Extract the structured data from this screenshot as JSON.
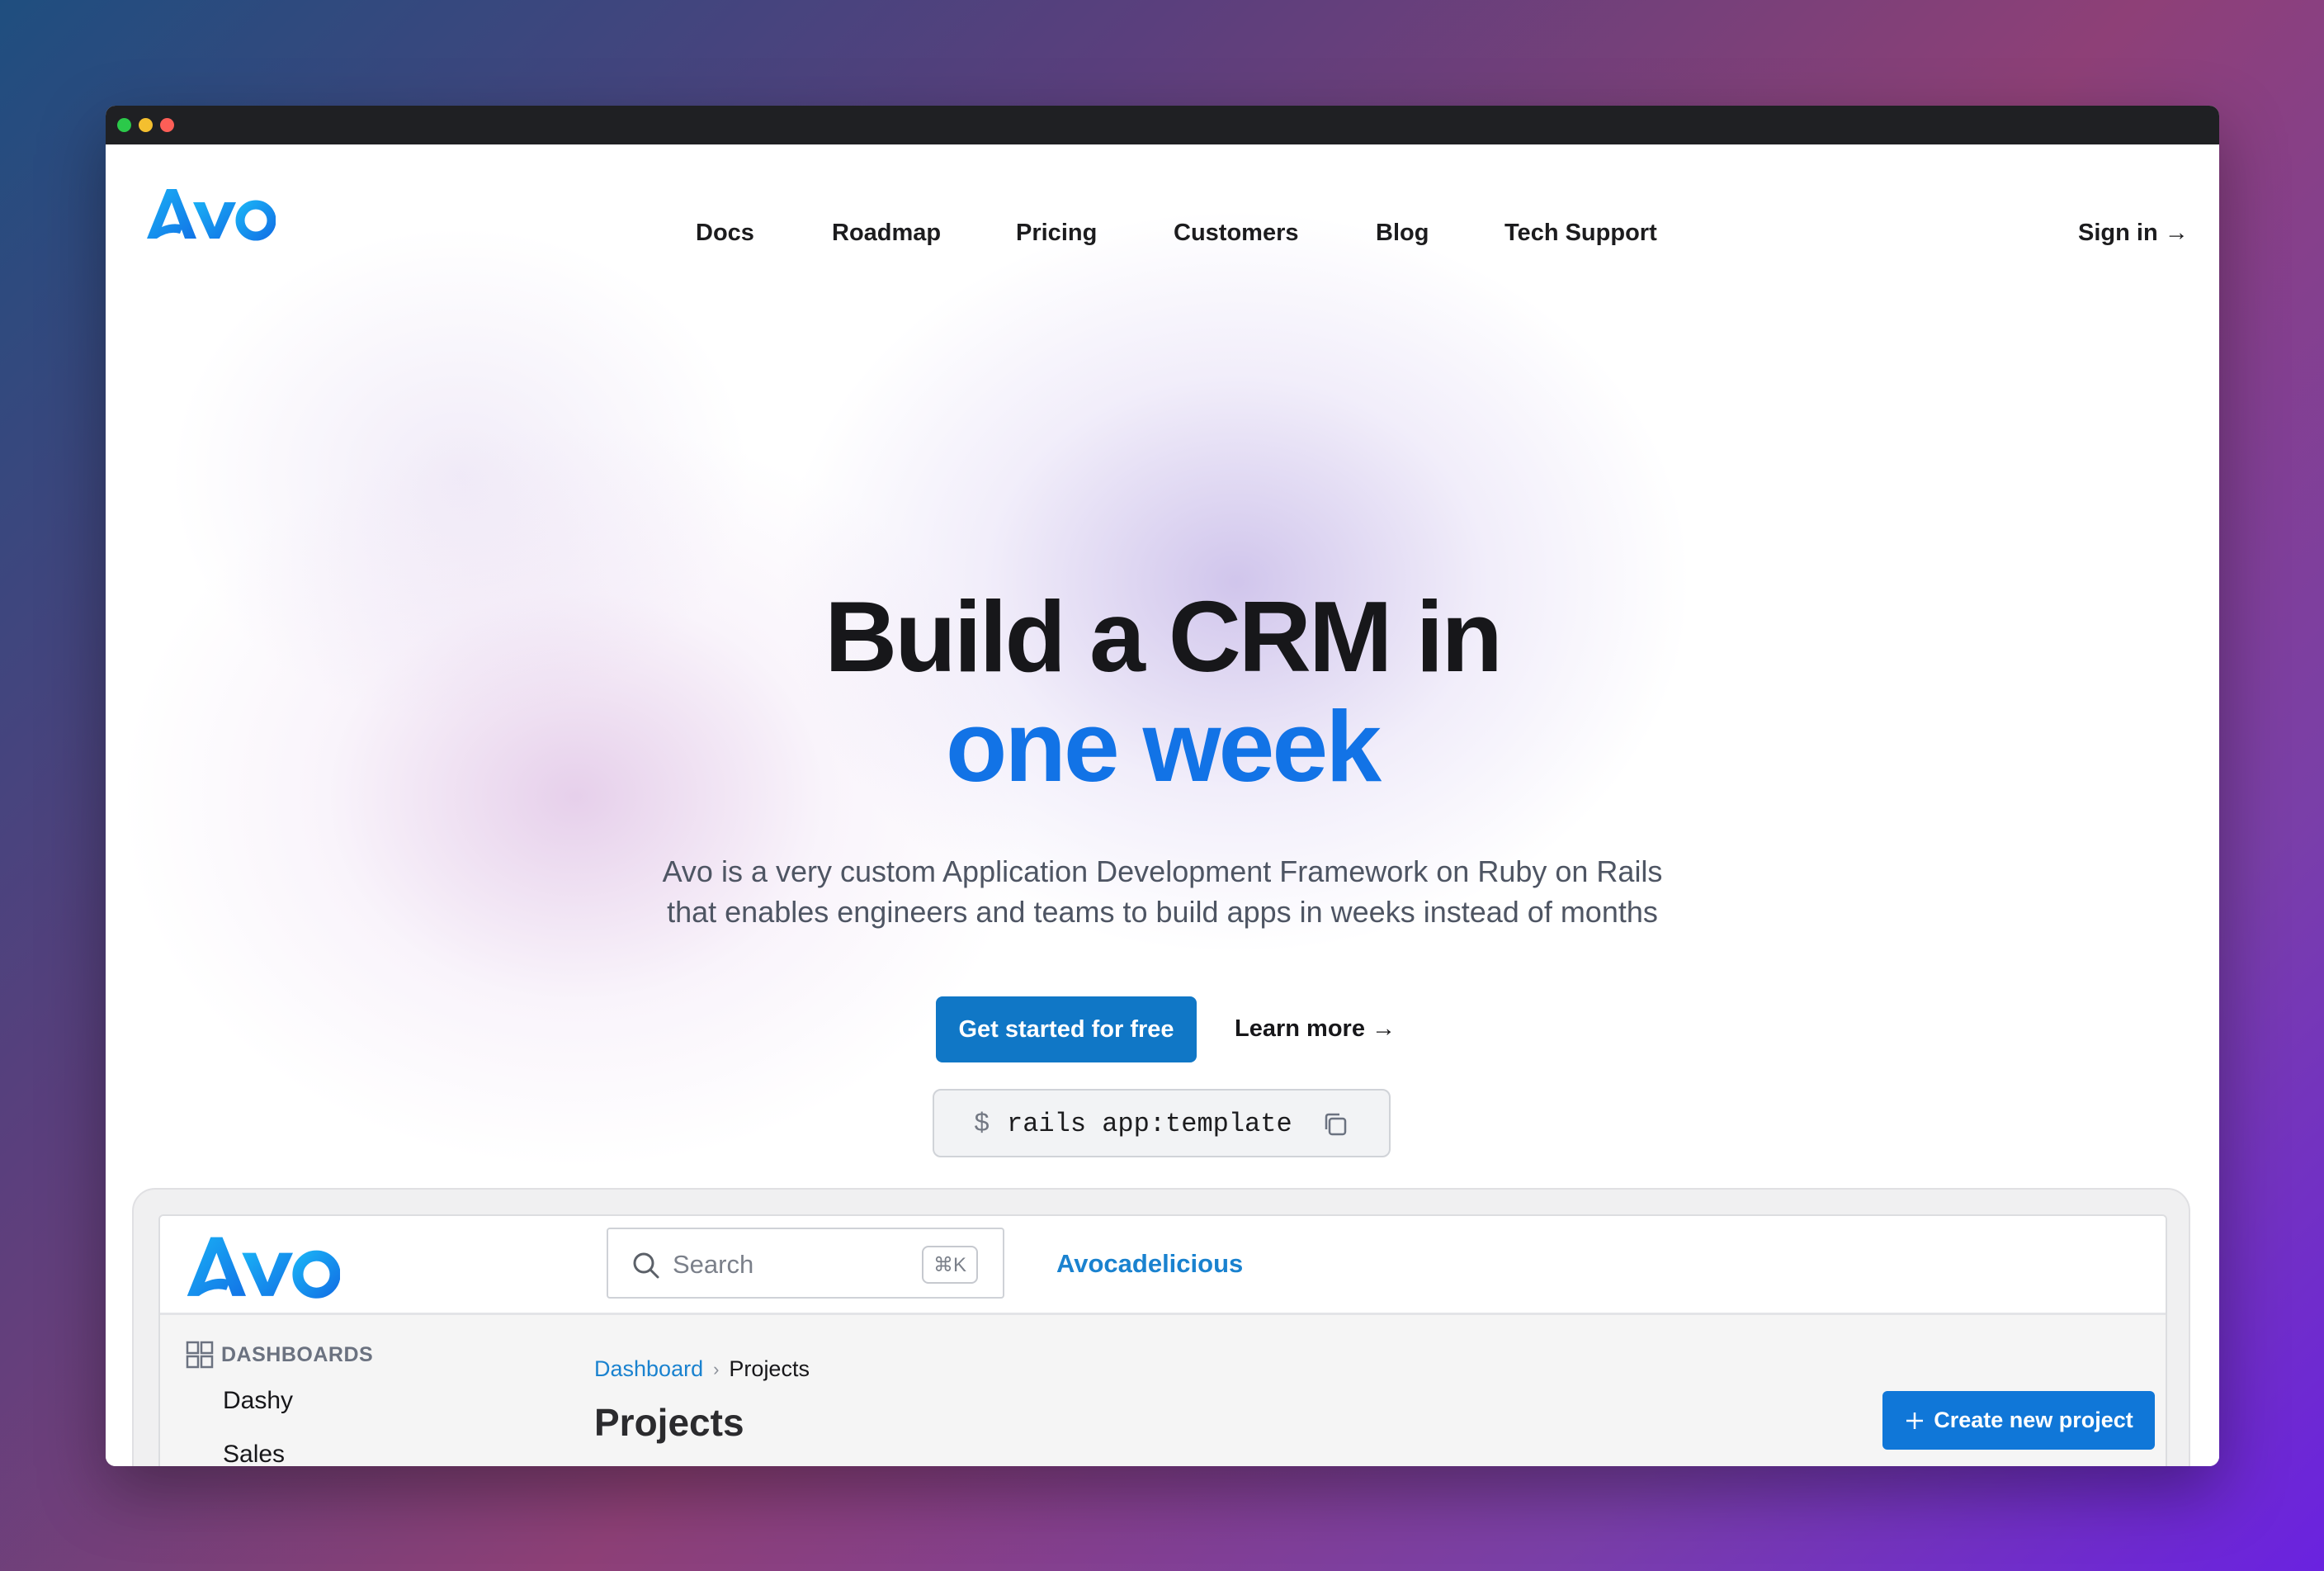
{
  "brand": {
    "name": "Avo",
    "primary_color": "#1273e6",
    "button_color": "#1077c6"
  },
  "nav": {
    "items": [
      "Docs",
      "Roadmap",
      "Pricing",
      "Customers",
      "Blog",
      "Tech Support"
    ],
    "sign_in": "Sign in →"
  },
  "hero": {
    "title_line1": "Build a CRM in",
    "title_line2": "one week",
    "subtitle_line1": "Avo is a very custom Application Development Framework on Ruby on Rails",
    "subtitle_line2": "that enables engineers and teams to build apps in weeks instead of months",
    "primary_cta": "Get started for free",
    "secondary_cta": "Learn more →",
    "command_prompt": "$",
    "command": "rails app:template"
  },
  "app_preview": {
    "search_placeholder": "Search",
    "search_shortcut": "⌘K",
    "tenant": "Avocadelicious",
    "sidebar_section": "DASHBOARDS",
    "sidebar_items": [
      "Dashy",
      "Sales"
    ],
    "breadcrumb": [
      "Dashboard",
      "Projects"
    ],
    "page_title": "Projects",
    "create_button": "Create new project"
  },
  "icons": [
    "copy-icon",
    "search-icon",
    "grid-icon",
    "chevron-right-icon",
    "plus-icon"
  ]
}
